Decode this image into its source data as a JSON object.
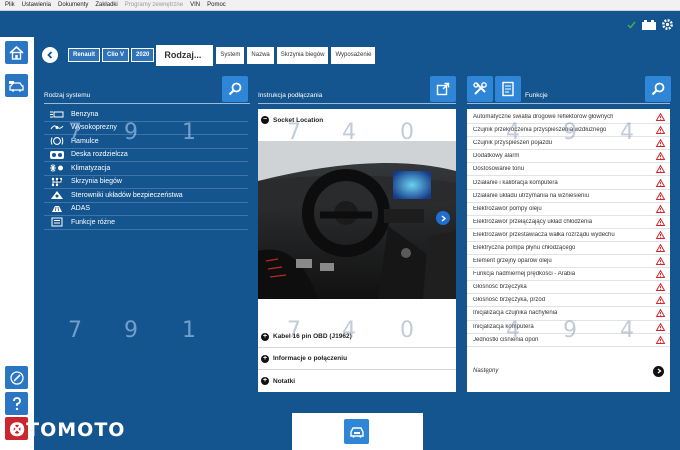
{
  "menu": [
    "Plik",
    "Ustawienia",
    "Dokumenty",
    "Zakładki",
    "Programy zewnętrzne",
    "VIN",
    "Pomoc"
  ],
  "breadcrumbs": [
    "Renault",
    "Clio V",
    "2020"
  ],
  "active_crumb": "Rodzaj...",
  "tabs": [
    "System",
    "Nazwa",
    "Skrzynia biegów",
    "Wyposażenie"
  ],
  "left_panel": {
    "title": "Rodzaj systemu",
    "items": [
      {
        "label": "Benzyna",
        "icon": "fuel-injector-icon"
      },
      {
        "label": "Wysokoprezny",
        "icon": "diesel-icon"
      },
      {
        "label": "Hamulce",
        "icon": "brake-icon"
      },
      {
        "label": "Deska rozdzielcza",
        "icon": "dashboard-icon"
      },
      {
        "label": "Klimatyzacja",
        "icon": "climate-icon"
      },
      {
        "label": "Skrzynia biegów",
        "icon": "gearbox-icon"
      },
      {
        "label": "Sterowniki układów bezpieczeństwa",
        "icon": "airbag-icon"
      },
      {
        "label": "ADAS",
        "icon": "adas-icon"
      },
      {
        "label": "Funkcje różne",
        "icon": "misc-icon"
      }
    ]
  },
  "middle_panel": {
    "title": "Instrukcja podłączania",
    "sections": [
      {
        "label": "Socket Location",
        "sign": "−"
      },
      {
        "label": "Kabel 16 pin OBD (J1962)",
        "sign": "+"
      },
      {
        "label": "Informacje o połączeniu",
        "sign": "+"
      },
      {
        "label": "Notatki",
        "sign": "+"
      }
    ]
  },
  "right_panel": {
    "title": "Funkcje",
    "items": [
      "Automatyczne światła drogowe reflektorów głównych",
      "Czujnik przekroczenia przyspieszenia wzdłużnego",
      "Czujnik przyspieszeń pojazdu",
      "Dodatkowy alarm",
      "Dostosowanie tonu",
      "Działanie i kalibracja komputera",
      "Działanie układu utrzymania na wzniesieniu",
      "Elektrozawór pompy oleju",
      "Elektrozawór przełączający układ chłodzenia",
      "Elektrozawór przestawiacza wałka rozrządu wydechu",
      "Elektryczna pompa płynu chłodzącego",
      "Element grzejny oparów oleju",
      "Funkcja nadmiernej prędkości - Arabia",
      "Głośność brzęczyka",
      "Głośność brzęczyka, przód",
      "Inicjalizacja czujnika nachylenia",
      "Inicjalizacja komputera",
      "Jednostki ciśnienia opon"
    ],
    "next_label": "Następny"
  },
  "watermark_digits": [
    "7",
    "9",
    "1",
    "7",
    "4",
    "0",
    "4",
    "9",
    "4"
  ],
  "brand": "OTOMOTO",
  "colors": {
    "background": "#15558f",
    "accent": "#2f86d6",
    "warning": "#d9232a"
  }
}
